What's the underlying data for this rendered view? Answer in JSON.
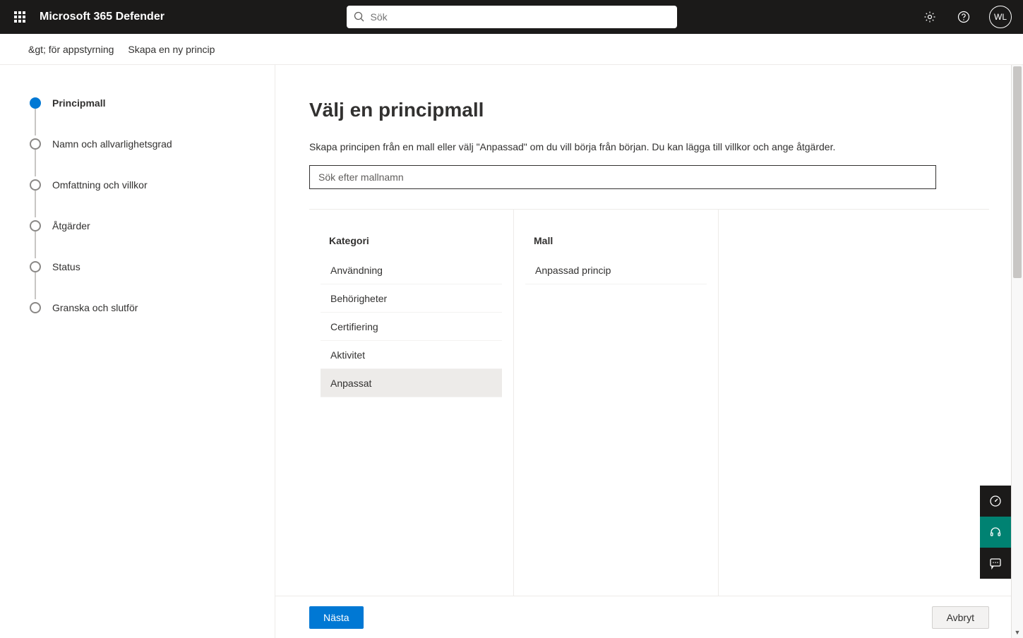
{
  "header": {
    "app_title": "Microsoft 365 Defender",
    "search_placeholder": "Sök",
    "avatar_initials": "WL"
  },
  "breadcrumb": {
    "items": [
      {
        "label": "&gt; för appstyrning"
      },
      {
        "label": "Skapa en ny princip"
      }
    ]
  },
  "wizard": {
    "steps": [
      {
        "label": "Principmall",
        "active": true
      },
      {
        "label": "Namn och allvarlighetsgrad",
        "active": false
      },
      {
        "label": "Omfattning och villkor",
        "active": false
      },
      {
        "label": "Åtgärder",
        "active": false
      },
      {
        "label": "Status",
        "active": false
      },
      {
        "label": "Granska och slutför",
        "active": false
      }
    ]
  },
  "main": {
    "title": "Välj en principmall",
    "description": "Skapa principen från en mall eller välj \"Anpassad\" om du vill börja från början. Du kan lägga till villkor och ange åtgärder.",
    "search_placeholder": "Sök efter mallnamn",
    "category_heading": "Kategori",
    "template_heading": "Mall",
    "categories": [
      {
        "label": "Användning",
        "selected": false
      },
      {
        "label": "Behörigheter",
        "selected": false
      },
      {
        "label": "Certifiering",
        "selected": false
      },
      {
        "label": "Aktivitet",
        "selected": false
      },
      {
        "label": "Anpassat",
        "selected": true
      }
    ],
    "templates": [
      {
        "label": "Anpassad princip"
      }
    ]
  },
  "footer": {
    "next_label": "Nästa",
    "cancel_label": "Avbryt"
  }
}
